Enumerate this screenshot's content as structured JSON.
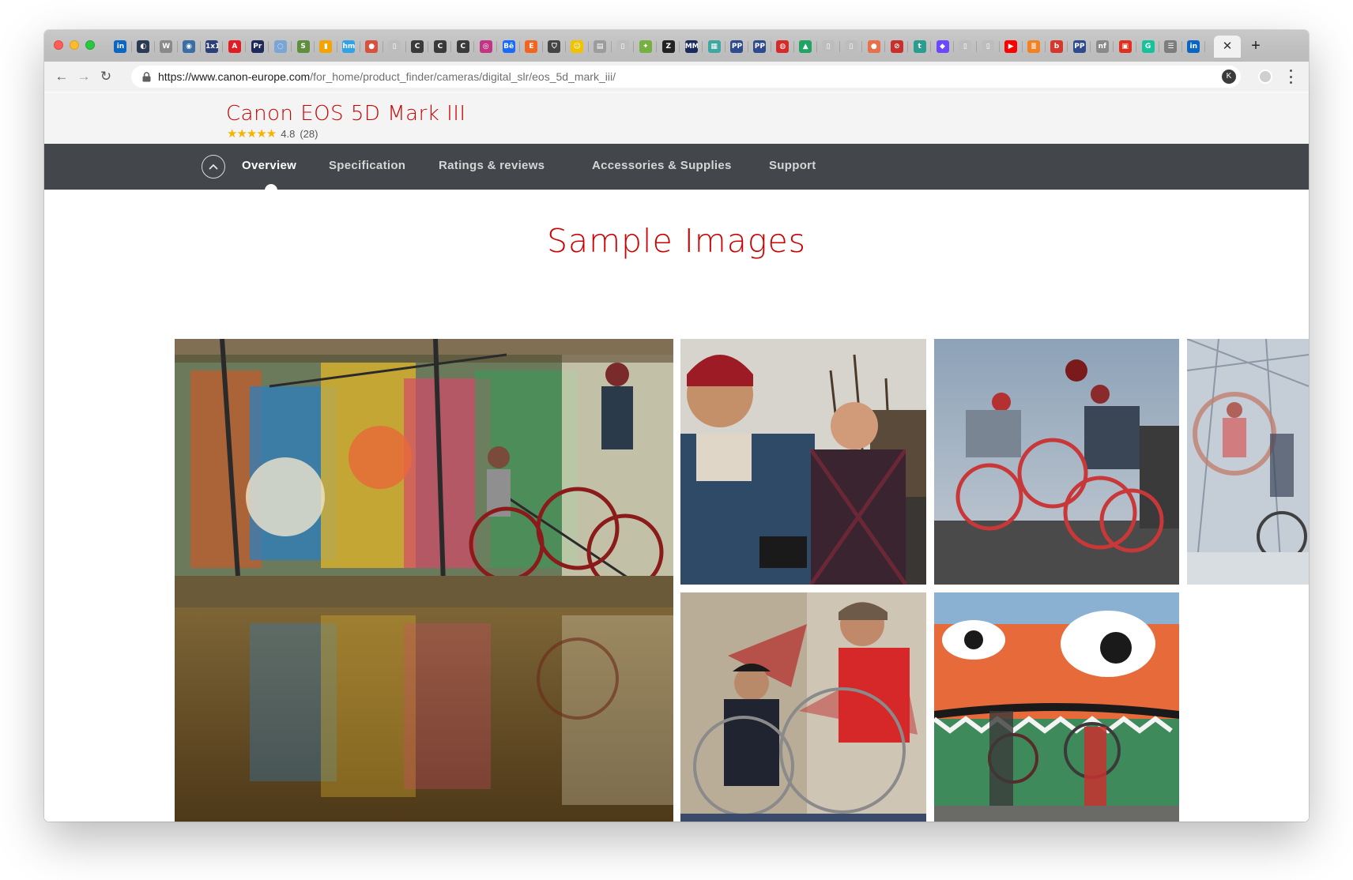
{
  "browser": {
    "url_host": "https://www.canon-europe.com",
    "url_path": "/for_home/product_finder/cameras/digital_slr/eos_5d_mark_iii/",
    "close_tab_glyph": "✕",
    "new_tab_glyph": "+",
    "back_glyph": "←",
    "forward_glyph": "→",
    "reload_glyph": "↻",
    "bookmark_glyph": "☆",
    "extension_label": "K",
    "pinned_tabs": [
      {
        "icon": "linkedin-icon",
        "text": "in",
        "bg": "#0a66c2"
      },
      {
        "icon": "globe-icon",
        "text": "◐",
        "bg": "#2b3a55"
      },
      {
        "icon": "wikipedia-icon",
        "text": "W",
        "bg": "#8a8a8a"
      },
      {
        "icon": "circle-blue-icon",
        "text": "◉",
        "bg": "#3a6ea5"
      },
      {
        "icon": "1x1-icon",
        "text": "1x1",
        "bg": "#2a3e7c"
      },
      {
        "icon": "adobe-icon",
        "text": "A",
        "bg": "#e31b23"
      },
      {
        "icon": "premiere-icon",
        "text": "Pr",
        "bg": "#1f2a5c"
      },
      {
        "icon": "swirl-icon",
        "text": "◌",
        "bg": "#7aa6d6"
      },
      {
        "icon": "shopify-icon",
        "text": "S",
        "bg": "#5e8e3e"
      },
      {
        "icon": "analytics-icon",
        "text": "▮",
        "bg": "#f4a300"
      },
      {
        "icon": "hemi-icon",
        "text": "hm",
        "bg": "#2fa3e6"
      },
      {
        "icon": "red-disc-icon",
        "text": "●",
        "bg": "#d7513e"
      },
      {
        "icon": "doc-icon",
        "text": "▯",
        "bg": "#bdbdbd"
      },
      {
        "icon": "c-icon",
        "text": "C",
        "bg": "#3a3a3a"
      },
      {
        "icon": "c-icon",
        "text": "C",
        "bg": "#3a3a3a"
      },
      {
        "icon": "c-icon",
        "text": "C",
        "bg": "#3a3a3a"
      },
      {
        "icon": "instagram-icon",
        "text": "◎",
        "bg": "#c13584"
      },
      {
        "icon": "behance-icon",
        "text": "Bē",
        "bg": "#1769ff"
      },
      {
        "icon": "etsy-icon",
        "text": "E",
        "bg": "#f16521"
      },
      {
        "icon": "shield-icon",
        "text": "⛉",
        "bg": "#444444"
      },
      {
        "icon": "smiley-icon",
        "text": "☺",
        "bg": "#f2c200"
      },
      {
        "icon": "notes-icon",
        "text": "▤",
        "bg": "#9c9c9c"
      },
      {
        "icon": "doc-icon",
        "text": "▯",
        "bg": "#bdbdbd"
      },
      {
        "icon": "leaf-icon",
        "text": "✦",
        "bg": "#76b041"
      },
      {
        "icon": "z-icon",
        "text": "Z",
        "bg": "#222222"
      },
      {
        "icon": "mm-icon",
        "text": "MM",
        "bg": "#1b2a5c"
      },
      {
        "icon": "grid-icon",
        "text": "▦",
        "bg": "#3fa7a2"
      },
      {
        "icon": "pp-icon",
        "text": "PP",
        "bg": "#2f4b8f"
      },
      {
        "icon": "pp-icon",
        "text": "PP",
        "bg": "#2f4b8f"
      },
      {
        "icon": "red-badge-icon",
        "text": "◍",
        "bg": "#d42b2b"
      },
      {
        "icon": "drive-icon",
        "text": "▲",
        "bg": "#1fa463"
      },
      {
        "icon": "doc-icon",
        "text": "▯",
        "bg": "#bdbdbd"
      },
      {
        "icon": "doc-icon",
        "text": "▯",
        "bg": "#bdbdbd"
      },
      {
        "icon": "orange-disc-icon",
        "text": "●",
        "bg": "#e8714a"
      },
      {
        "icon": "no-entry-icon",
        "text": "⊘",
        "bg": "#c9302c"
      },
      {
        "icon": "teal-icon",
        "text": "t",
        "bg": "#2a9d8f"
      },
      {
        "icon": "purple-icon",
        "text": "◆",
        "bg": "#6c47ff"
      },
      {
        "icon": "doc-icon",
        "text": "▯",
        "bg": "#bdbdbd"
      },
      {
        "icon": "doc-icon",
        "text": "▯",
        "bg": "#bdbdbd"
      },
      {
        "icon": "youtube-icon",
        "text": "▶",
        "bg": "#ff0000"
      },
      {
        "icon": "stack-icon",
        "text": "≣",
        "bg": "#f48024"
      },
      {
        "icon": "b-icon",
        "text": "b",
        "bg": "#d9362b"
      },
      {
        "icon": "pp-icon",
        "text": "PP",
        "bg": "#2f4b8f"
      },
      {
        "icon": "sketch-icon",
        "text": "nf",
        "bg": "#8a8a8a"
      },
      {
        "icon": "square-red-icon",
        "text": "▣",
        "bg": "#e0301e"
      },
      {
        "icon": "grammarly-icon",
        "text": "G",
        "bg": "#15c39a"
      },
      {
        "icon": "menu-icon",
        "text": "☰",
        "bg": "#7d7d7d"
      },
      {
        "icon": "linkedin-icon",
        "text": "in",
        "bg": "#0a66c2"
      }
    ]
  },
  "product": {
    "title": "Canon EOS 5D Mark III",
    "stars": "★★★★★",
    "rating": "4.8",
    "review_count": "(28)"
  },
  "product_nav": {
    "items": [
      {
        "label": "Overview",
        "active": true
      },
      {
        "label": "Specification",
        "active": false
      },
      {
        "label": "Ratings & reviews",
        "active": false
      },
      {
        "label": "Accessories & Supplies",
        "active": false
      },
      {
        "label": "Support",
        "active": false
      }
    ]
  },
  "gallery": {
    "title": "Sample Images",
    "images": [
      {
        "subject": "graffiti-reflection-cyclists-photo"
      },
      {
        "subject": "two-men-portrait-photo"
      },
      {
        "subject": "bike-polo-jump-photo"
      },
      {
        "subject": "dome-cyclists-photo"
      },
      {
        "subject": "wheel-repair-photo"
      },
      {
        "subject": "mural-wall-cyclists-photo"
      }
    ]
  },
  "colors": {
    "brand_red": "#cc0000",
    "nav_bar": "#43464b",
    "header_bg": "#f4f4f4",
    "star_gold": "#f5b400"
  }
}
